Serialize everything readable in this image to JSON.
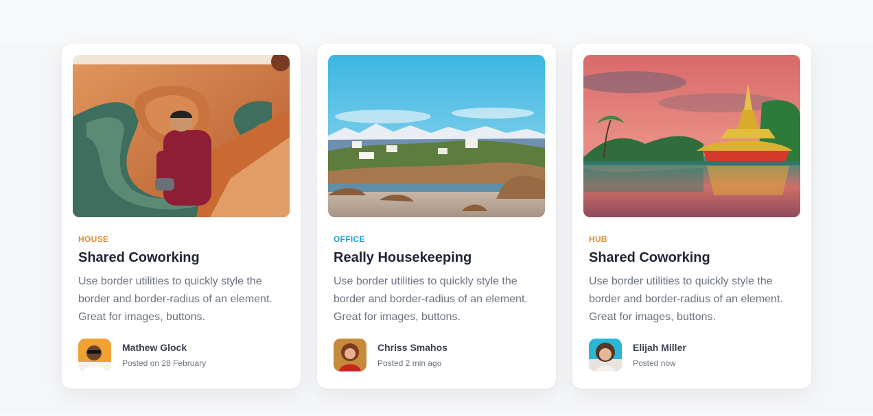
{
  "cards": [
    {
      "image": "canyon-photo",
      "category": "House",
      "category_color": "#e08a2f",
      "title": "Shared Coworking",
      "description": "Use border utilities to quickly style the border and border-radius of an element. Great for images, buttons.",
      "author": {
        "name": "Mathew Glock",
        "posted": "Posted on 28 February",
        "avatar": "avatar-man-sunglasses"
      }
    },
    {
      "image": "coastal-village-photo",
      "category": "Office",
      "category_color": "#1fa1d4",
      "title": "Really Housekeeping",
      "description": "Use border utilities to quickly style the border and border-radius of an element. Great for images, buttons.",
      "author": {
        "name": "Chriss Smahos",
        "posted": "Posted 2 min ago",
        "avatar": "avatar-woman-red"
      }
    },
    {
      "image": "temple-lake-photo",
      "category": "Hub",
      "category_color": "#e08a2f",
      "title": "Shared Coworking",
      "description": "Use border utilities to quickly style the border and border-radius of an element. Great for images, buttons.",
      "author": {
        "name": "Elijah Miller",
        "posted": "Posted now",
        "avatar": "avatar-woman-blue"
      }
    }
  ]
}
